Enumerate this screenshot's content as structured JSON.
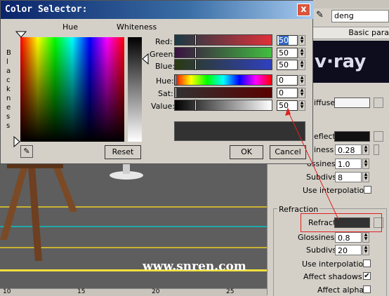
{
  "dialog": {
    "title": "Color Selector:",
    "close_label": "x",
    "hue_label": "Hue",
    "whiteness_label": "Whiteness",
    "blackness_label": "B l a c k n e s s",
    "red_label": "Red:",
    "green_label": "Green:",
    "blue_label": "Blue:",
    "hue2_label": "Hue:",
    "sat_label": "Sat:",
    "value_label": "Value:",
    "red_value": "50",
    "green_value": "50",
    "blue_value": "50",
    "hue_value": "0",
    "sat_value": "0",
    "value_value": "50",
    "reset_label": "Reset",
    "ok_label": "OK",
    "cancel_label": "Cancel",
    "preview_color": "#323232"
  },
  "right_panel": {
    "name_field": "deng",
    "section_header": "Basic para",
    "logo_text": "v·ray",
    "diffuse_label": "iffuse",
    "reflect_label": "eflect",
    "refl_glossiness_label": "iness",
    "refl_glossiness_value": "0.28",
    "refl_hilight_label": "ossiness",
    "refl_hilight_value": "1.0",
    "refl_subdivs_label": "Subdivs",
    "refl_subdivs_value": "8",
    "refl_use_interp_label": "Use interpolation",
    "refraction_group_label": "Refraction",
    "refract_label": "Refract",
    "refr_glossiness_label": "Glossiness",
    "refr_glossiness_value": "0.8",
    "refr_subdivs_label": "Subdivs",
    "refr_subdivs_value": "20",
    "refr_use_interp_label": "Use interpolation",
    "affect_shadows_label": "Affect shadows",
    "affect_shadows_check": "✔",
    "affect_alpha_label": "Affect alpha"
  },
  "viewport": {
    "watermark": "www.snren.com",
    "ruler_ticks": [
      "10",
      "15",
      "20",
      "25"
    ]
  },
  "colors": {
    "title_bar": "#0a246a",
    "highlight_box": "#e02020",
    "viewport_line_yellow": "#d8c020",
    "viewport_line_cyan": "#20b0b0"
  }
}
